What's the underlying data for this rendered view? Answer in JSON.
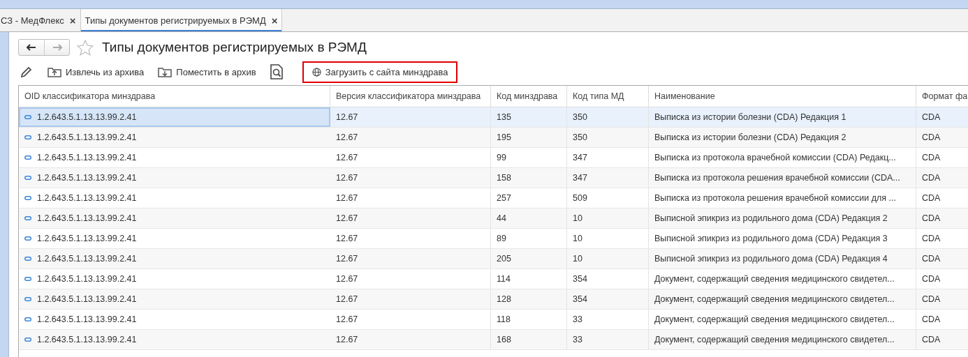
{
  "tabs": [
    {
      "label": "СЗ - МедФлекс",
      "close": "×",
      "selected": false
    },
    {
      "label": "Типы документов регистрируемых в РЭМД",
      "close": "×",
      "selected": true
    }
  ],
  "page": {
    "title": "Типы документов регистрируемых в РЭМД",
    "favorite": false
  },
  "toolbar": [
    {
      "kind": "edit"
    },
    {
      "kind": "unarchive",
      "label": "Извлечь из архива",
      "highlighted": false
    },
    {
      "kind": "archive",
      "label": "Поместить в архив",
      "highlighted": false
    },
    {
      "kind": "preview"
    },
    {
      "kind": "download",
      "label": "Загрузить с сайта минздрава",
      "highlighted": true
    }
  ],
  "table": {
    "columns": [
      "OID классификатора минздрава",
      "Версия классификатора минздрава",
      "Код минздрава",
      "Код типа МД",
      "Наименование",
      "Формат фа"
    ],
    "rows": [
      {
        "selected": true,
        "cells": [
          "1.2.643.5.1.13.13.99.2.41",
          "12.67",
          "135",
          "350",
          "Выписка из истории болезни (CDA) Редакция 1",
          "CDA"
        ]
      },
      {
        "selected": false,
        "cells": [
          "1.2.643.5.1.13.13.99.2.41",
          "12.67",
          "195",
          "350",
          "Выписка из истории болезни (CDA) Редакция 2",
          "CDA"
        ]
      },
      {
        "selected": false,
        "cells": [
          "1.2.643.5.1.13.13.99.2.41",
          "12.67",
          "99",
          "347",
          "Выписка из протокола врачебной комиссии (CDA) Редакц...",
          "CDA"
        ]
      },
      {
        "selected": false,
        "cells": [
          "1.2.643.5.1.13.13.99.2.41",
          "12.67",
          "158",
          "347",
          "Выписка из протокола решения врачебной комиссии (CDA...",
          "CDA"
        ]
      },
      {
        "selected": false,
        "cells": [
          "1.2.643.5.1.13.13.99.2.41",
          "12.67",
          "257",
          "509",
          "Выписка из протокола решения врачебной комиссии для ...",
          "CDA"
        ]
      },
      {
        "selected": false,
        "cells": [
          "1.2.643.5.1.13.13.99.2.41",
          "12.67",
          "44",
          "10",
          "Выписной эпикриз из родильного дома (CDA) Редакция 2",
          "CDA"
        ]
      },
      {
        "selected": false,
        "cells": [
          "1.2.643.5.1.13.13.99.2.41",
          "12.67",
          "89",
          "10",
          "Выписной эпикриз из родильного дома (CDA) Редакция 3",
          "CDA"
        ]
      },
      {
        "selected": false,
        "cells": [
          "1.2.643.5.1.13.13.99.2.41",
          "12.67",
          "205",
          "10",
          "Выписной эпикриз из родильного дома (CDA) Редакция 4",
          "CDA"
        ]
      },
      {
        "selected": false,
        "cells": [
          "1.2.643.5.1.13.13.99.2.41",
          "12.67",
          "114",
          "354",
          "Документ, содержащий сведения медицинского свидетел...",
          "CDA"
        ]
      },
      {
        "selected": false,
        "cells": [
          "1.2.643.5.1.13.13.99.2.41",
          "12.67",
          "128",
          "354",
          "Документ, содержащий сведения медицинского свидетел...",
          "CDA"
        ]
      },
      {
        "selected": false,
        "cells": [
          "1.2.643.5.1.13.13.99.2.41",
          "12.67",
          "118",
          "33",
          "Документ, содержащий сведения медицинского свидетел...",
          "CDA"
        ]
      },
      {
        "selected": false,
        "cells": [
          "1.2.643.5.1.13.13.99.2.41",
          "12.67",
          "168",
          "33",
          "Документ, содержащий сведения медицинского свидетел...",
          "CDA"
        ]
      }
    ]
  }
}
